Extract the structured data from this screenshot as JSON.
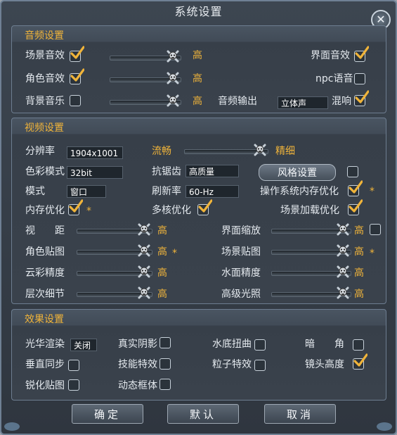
{
  "window": {
    "title": "系统设置",
    "close_label": "✕"
  },
  "audio": {
    "title": "音频设置",
    "scene_sound": "场景音效",
    "scene_sound_checked": true,
    "scene_sound_level": "高",
    "ui_sound": "界面音效",
    "ui_sound_checked": true,
    "role_sound": "角色音效",
    "role_sound_checked": true,
    "role_sound_level": "高",
    "npc_voice": "npc语音",
    "npc_voice_checked": false,
    "bgm": "背景音乐",
    "bgm_checked": false,
    "bgm_level": "高",
    "output_label": "音频输出",
    "output_value": "立体声",
    "reverb": "混响",
    "reverb_checked": true
  },
  "video": {
    "title": "视频设置",
    "resolution_label": "分辨率",
    "resolution_value": "1904x1001",
    "smooth": "流畅",
    "fine": "精细",
    "color_mode_label": "色彩模式",
    "color_mode_value": "32bit",
    "aa_label": "抗锯齿",
    "aa_value": "高质量",
    "style_button": "风格设置",
    "style_checked": false,
    "mode_label": "模式",
    "mode_value": "窗口",
    "refresh_label": "刷新率",
    "refresh_value": "60-Hz",
    "os_mem": "操作系统内存优化",
    "os_mem_checked": true,
    "mem_opt": "内存优化",
    "mem_opt_checked": true,
    "multicore": "多核优化",
    "multicore_checked": true,
    "scene_load": "场景加载优化",
    "scene_load_checked": true,
    "view_dist": "视　　距",
    "view_dist_level": "高",
    "ui_scale": "界面缩放",
    "ui_scale_level": "高",
    "ui_scale_checked": false,
    "role_tex": "角色贴图",
    "role_tex_level": "高",
    "scene_tex": "场景贴图",
    "scene_tex_level": "高",
    "cloud": "云彩精度",
    "cloud_level": "高",
    "water": "水面精度",
    "water_level": "高",
    "lod": "层次细节",
    "lod_level": "高",
    "hq_light": "高级光照",
    "hq_light_level": "高",
    "star": "*"
  },
  "effects": {
    "title": "效果设置",
    "bloom": "光华渲染",
    "bloom_value": "关闭",
    "shadow": "真实阴影",
    "shadow_checked": false,
    "underwater": "水底扭曲",
    "underwater_checked": false,
    "vignette": "暗　　角",
    "vignette_checked": false,
    "vsync": "垂直同步",
    "vsync_checked": false,
    "skill_fx": "技能特效",
    "skill_fx_checked": false,
    "particle": "粒子特效",
    "particle_checked": false,
    "cam_height": "镜头高度",
    "cam_height_checked": true,
    "sharpen": "锐化贴图",
    "sharpen_checked": false,
    "dyn_frame": "动态框体",
    "dyn_frame_checked": false
  },
  "footer": {
    "ok": "确定",
    "default": "默认",
    "cancel": "取消"
  },
  "sliders": {
    "scene_sound": 1.0,
    "role_sound": 1.0,
    "bgm": 1.0,
    "quality": 1.0,
    "view_dist": 1.0,
    "ui_scale": 1.0,
    "role_tex": 1.0,
    "scene_tex": 1.0,
    "cloud": 1.0,
    "water": 1.0,
    "lod": 1.0,
    "hq_light": 1.0
  },
  "colors": {
    "accent": "#f0b43a",
    "check": "#f0b43a"
  }
}
